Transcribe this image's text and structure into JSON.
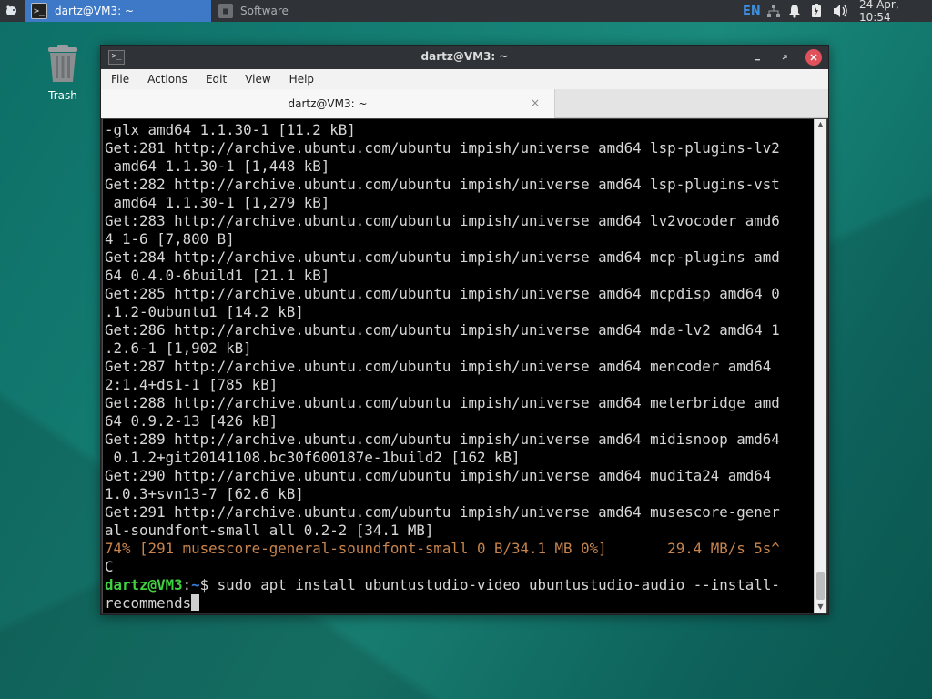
{
  "panel": {
    "tasks": [
      {
        "label": "dartz@VM3: ~",
        "active": true
      },
      {
        "label": "Software",
        "active": false
      }
    ],
    "tray": {
      "language": "EN",
      "clock": "24 Apr, 10:54"
    }
  },
  "desktop": {
    "icons": [
      {
        "label": "Trash"
      }
    ]
  },
  "window": {
    "title": "dartz@VM3: ~",
    "menu": [
      "File",
      "Actions",
      "Edit",
      "View",
      "Help"
    ],
    "tab": {
      "label": "dartz@VM3: ~",
      "close": "×"
    }
  },
  "terminal": {
    "lines": [
      "-glx amd64 1.1.30-1 [11.2 kB]",
      "Get:281 http://archive.ubuntu.com/ubuntu impish/universe amd64 lsp-plugins-lv2",
      " amd64 1.1.30-1 [1,448 kB]",
      "Get:282 http://archive.ubuntu.com/ubuntu impish/universe amd64 lsp-plugins-vst",
      " amd64 1.1.30-1 [1,279 kB]",
      "Get:283 http://archive.ubuntu.com/ubuntu impish/universe amd64 lv2vocoder amd6",
      "4 1-6 [7,800 B]",
      "Get:284 http://archive.ubuntu.com/ubuntu impish/universe amd64 mcp-plugins amd",
      "64 0.4.0-6build1 [21.1 kB]",
      "Get:285 http://archive.ubuntu.com/ubuntu impish/universe amd64 mcpdisp amd64 0",
      ".1.2-0ubuntu1 [14.2 kB]",
      "Get:286 http://archive.ubuntu.com/ubuntu impish/universe amd64 mda-lv2 amd64 1",
      ".2.6-1 [1,902 kB]",
      "Get:287 http://archive.ubuntu.com/ubuntu impish/universe amd64 mencoder amd64",
      "2:1.4+ds1-1 [785 kB]",
      "Get:288 http://archive.ubuntu.com/ubuntu impish/universe amd64 meterbridge amd",
      "64 0.9.2-13 [426 kB]",
      "Get:289 http://archive.ubuntu.com/ubuntu impish/universe amd64 midisnoop amd64",
      " 0.1.2+git20141108.bc30f600187e-1build2 [162 kB]",
      "Get:290 http://archive.ubuntu.com/ubuntu impish/universe amd64 mudita24 amd64",
      "1.0.3+svn13-7 [62.6 kB]",
      "Get:291 http://archive.ubuntu.com/ubuntu impish/universe amd64 musescore-gener",
      "al-soundfont-small all 0.2-2 [34.1 MB]"
    ],
    "progress_line": "74% [291 musescore-general-soundfont-small 0 B/34.1 MB 0%]       29.4 MB/s 5s^",
    "after_progress": "C",
    "prompt": {
      "user_host": "dartz@VM3",
      "sep": ":",
      "path": "~",
      "symbol": "$",
      "command_line1": " sudo apt install ubuntustudio-video ubuntustudio-audio --install-",
      "command_line2": "recommends"
    }
  },
  "colors": {
    "panel_bg": "#2f3337",
    "active_task": "#3d79c7",
    "close_button": "#e0525b",
    "prompt_user": "#3fd13f",
    "prompt_path": "#3a7bd5",
    "progress_text": "#c8844c"
  }
}
